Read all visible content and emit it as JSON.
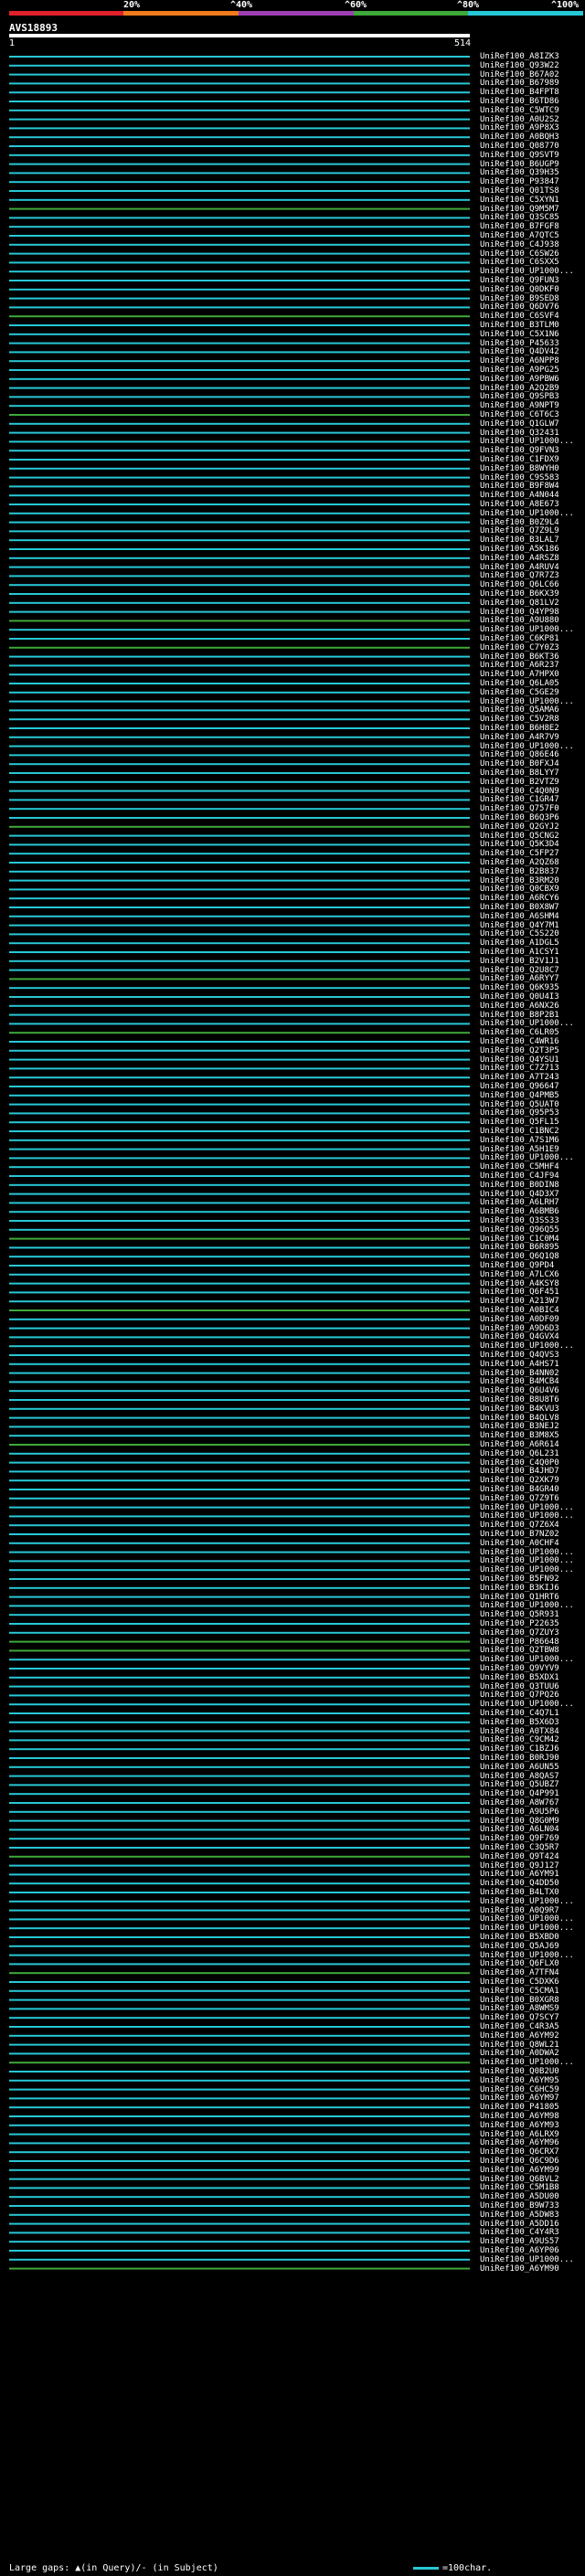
{
  "legend": {
    "labels": [
      "20%",
      "^40%",
      "^60%",
      "^80%",
      "^100%"
    ],
    "colors": [
      "#e0202a",
      "#f07b1c",
      "#9b3fb3",
      "#3fa83a",
      "#27c8d6"
    ]
  },
  "query": {
    "id": "AVS18893",
    "start": "1",
    "end": "514"
  },
  "footer": {
    "gaps": "Large gaps: ▲(in Query)/- (in Subject)",
    "scale": "=100char."
  },
  "hits": [
    "UniRef100_A8IZK3",
    "UniRef100_Q93W22",
    "UniRef100_B67A02",
    "UniRef100_B67989",
    "UniRef100_B4FPT8",
    "UniRef100_B6TD86",
    "UniRef100_C5WTC9",
    "UniRef100_A0U2S2",
    "UniRef100_A9P8X3",
    "UniRef100_A0BQH3",
    "UniRef100_Q08770",
    "UniRef100_Q9SVT9",
    "UniRef100_B6UGP9",
    "UniRef100_Q39H35",
    "UniRef100_P93847",
    "UniRef100_Q01TS8",
    "UniRef100_C5XYN1",
    "UniRef100_Q9M5M7",
    "UniRef100_Q3SC85",
    "UniRef100_B7FGF8",
    "UniRef100_A7QTC5",
    "UniRef100_C4J938",
    "UniRef100_C6SW26",
    "UniRef100_C6SXX5",
    "UniRef100_UP1000...",
    "UniRef100_Q9FUN3",
    "UniRef100_Q0DKF0",
    "UniRef100_B9SED8",
    "UniRef100_Q6DV76",
    "UniRef100_C6SVF4",
    "UniRef100_B3TLM0",
    "UniRef100_C5X1N6",
    "UniRef100_P45633",
    "UniRef100_Q4DV42",
    "UniRef100_A6NPP8",
    "UniRef100_A9PG25",
    "UniRef100_A9PBW6",
    "UniRef100_A2Q2B9",
    "UniRef100_Q9SPB3",
    "UniRef100_A9NPT9",
    "UniRef100_C6T6C3",
    "UniRef100_Q1GLW7",
    "UniRef100_Q32431",
    "UniRef100_UP1000...",
    "UniRef100_Q9FVN3",
    "UniRef100_C1FDX9",
    "UniRef100_B8WYH0",
    "UniRef100_C9S583",
    "UniRef100_B9F8W4",
    "UniRef100_A4N044",
    "UniRef100_A8E673",
    "UniRef100_UP1000...",
    "UniRef100_B0Z9L4",
    "UniRef100_Q7Z9L9",
    "UniRef100_B3LAL7",
    "UniRef100_A5K186",
    "UniRef100_A4RSZ8",
    "UniRef100_A4RUV4",
    "UniRef100_Q7R7Z3",
    "UniRef100_Q6LC66",
    "UniRef100_B6KX39",
    "UniRef100_Q81LV2",
    "UniRef100_Q4YP98",
    "UniRef100_A9U880",
    "UniRef100_UP1000...",
    "UniRef100_C6KP81",
    "UniRef100_C7Y0Z3",
    "UniRef100_B6KT36",
    "UniRef100_A6R237",
    "UniRef100_A7HPX0",
    "UniRef100_Q6LA05",
    "UniRef100_C5GE29",
    "UniRef100_UP1000...",
    "UniRef100_Q5AMA6",
    "UniRef100_C5V2R8",
    "UniRef100_B6H8E2",
    "UniRef100_A4R7V9",
    "UniRef100_UP1000...",
    "UniRef100_Q86E46",
    "UniRef100_B0FXJ4",
    "UniRef100_B8LYY7",
    "UniRef100_B2VTZ9",
    "UniRef100_C4Q0N9",
    "UniRef100_C1GR47",
    "UniRef100_Q757F0",
    "UniRef100_B6Q3P6",
    "UniRef100_Q2GYJ2",
    "UniRef100_Q5CNG2",
    "UniRef100_Q5K3D4",
    "UniRef100_C5FP27",
    "UniRef100_A2QZ68",
    "UniRef100_B2B837",
    "UniRef100_B3RM20",
    "UniRef100_Q0CBX9",
    "UniRef100_A6RCY6",
    "UniRef100_B0X8W7",
    "UniRef100_A6SHM4",
    "UniRef100_Q4Y7M1",
    "UniRef100_C5S220",
    "UniRef100_A1DGL5",
    "UniRef100_A1CSY1",
    "UniRef100_B2V1J1",
    "UniRef100_Q2U8C7",
    "UniRef100_A6RYY7",
    "UniRef100_Q6K935",
    "UniRef100_Q0U4I3",
    "UniRef100_A6NX26",
    "UniRef100_B8P2B1",
    "UniRef100_UP1000...",
    "UniRef100_C6LR05",
    "UniRef100_C4WR16",
    "UniRef100_Q2T3P5",
    "UniRef100_Q4YSU1",
    "UniRef100_C7Z713",
    "UniRef100_A7T243",
    "UniRef100_Q96647",
    "UniRef100_Q4PMB5",
    "UniRef100_Q5UAT0",
    "UniRef100_Q95P53",
    "UniRef100_Q5FL15",
    "UniRef100_C1BNC2",
    "UniRef100_A7S1M6",
    "UniRef100_A5H1E9",
    "UniRef100_UP1000...",
    "UniRef100_C5MHF4",
    "UniRef100_C4JF94",
    "UniRef100_B0DIN8",
    "UniRef100_Q4D3X7",
    "UniRef100_A6LRH7",
    "UniRef100_A6BMB6",
    "UniRef100_Q3SS33",
    "UniRef100_Q96Q55",
    "UniRef100_C1C0M4",
    "UniRef100_B6R895",
    "UniRef100_Q6Q1Q8",
    "UniRef100_Q9PD4",
    "UniRef100_A7LCX6",
    "UniRef100_A4KSY8",
    "UniRef100_Q6F451",
    "UniRef100_A213W7",
    "UniRef100_A0BIC4",
    "UniRef100_A0DF09",
    "UniRef100_A9D6D3",
    "UniRef100_Q4GVX4",
    "UniRef100_UP1000...",
    "UniRef100_Q4QVS3",
    "UniRef100_A4HS71",
    "UniRef100_B4NN02",
    "UniRef100_B4MCB4",
    "UniRef100_Q6U4V6",
    "UniRef100_B8U8T6",
    "UniRef100_B4KVU3",
    "UniRef100_B4QLV8",
    "UniRef100_B3NEJ2",
    "UniRef100_B3M8X5",
    "UniRef100_A6R614",
    "UniRef100_Q6L231",
    "UniRef100_C4Q0P0",
    "UniRef100_B4JHD7",
    "UniRef100_Q2XK79",
    "UniRef100_B4GR40",
    "UniRef100_Q7Z9T6",
    "UniRef100_UP1000...",
    "UniRef100_UP1000...",
    "UniRef100_Q7Z6X4",
    "UniRef100_B7NZ02",
    "UniRef100_A0CHF4",
    "UniRef100_UP1000...",
    "UniRef100_UP1000...",
    "UniRef100_UP1000...",
    "UniRef100_B5FN92",
    "UniRef100_B3KIJ6",
    "UniRef100_Q1HRT6",
    "UniRef100_UP1000...",
    "UniRef100_Q5R931",
    "UniRef100_P22635",
    "UniRef100_Q7ZUY3",
    "UniRef100_P86648",
    "UniRef100_Q2TBW8",
    "UniRef100_UP1000...",
    "UniRef100_Q9VYV9",
    "UniRef100_B5XDX1",
    "UniRef100_Q3TUU6",
    "UniRef100_Q7PQ26",
    "UniRef100_UP1000...",
    "UniRef100_C4Q7L1",
    "UniRef100_B5X6D3",
    "UniRef100_A0TX84",
    "UniRef100_C9CM42",
    "UniRef100_C1BZJ6",
    "UniRef100_B0RJ90",
    "UniRef100_A6UN55",
    "UniRef100_A8QAS7",
    "UniRef100_Q5UBZ7",
    "UniRef100_Q4P991",
    "UniRef100_A8W767",
    "UniRef100_A9U5P6",
    "UniRef100_Q8G0M9",
    "UniRef100_A6LN04",
    "UniRef100_Q9F769",
    "UniRef100_C3Q5R7",
    "UniRef100_Q9T424",
    "UniRef100_Q9J127",
    "UniRef100_A6YM91",
    "UniRef100_Q4DD50",
    "UniRef100_B4LTX0",
    "UniRef100_UP1000...",
    "UniRef100_A0Q9R7",
    "UniRef100_UP1000...",
    "UniRef100_UP1000...",
    "UniRef100_B5XBD0",
    "UniRef100_Q5AJ69",
    "UniRef100_UP1000...",
    "UniRef100_Q6FLX0",
    "UniRef100_A7TFN4",
    "UniRef100_C5DXK6",
    "UniRef100_C5CMA1",
    "UniRef100_B0XGR8",
    "UniRef100_A8WMS9",
    "UniRef100_Q7SCY7",
    "UniRef100_C4R3A5",
    "UniRef100_A6YM92",
    "UniRef100_Q8WL21",
    "UniRef100_A0DWA2",
    "UniRef100_UP1000...",
    "UniRef100_Q0B2U0",
    "UniRef100_A6YM95",
    "UniRef100_C6HC59",
    "UniRef100_A6YM97",
    "UniRef100_P41805",
    "UniRef100_A6YM98",
    "UniRef100_A6YM93",
    "UniRef100_A6LRX9",
    "UniRef100_A6YM96",
    "UniRef100_Q6CRX7",
    "UniRef100_Q6C9D6",
    "UniRef100_A6YM99",
    "UniRef100_Q6BVL2",
    "UniRef100_C5M1B8",
    "UniRef100_A5DU00",
    "UniRef100_B9W733",
    "UniRef100_A5DW83",
    "UniRef100_A5DD16",
    "UniRef100_C4Y4R3",
    "UniRef100_A9US57",
    "UniRef100_A6YP06",
    "UniRef100_UP1000...",
    "UniRef100_A6YM90"
  ]
}
